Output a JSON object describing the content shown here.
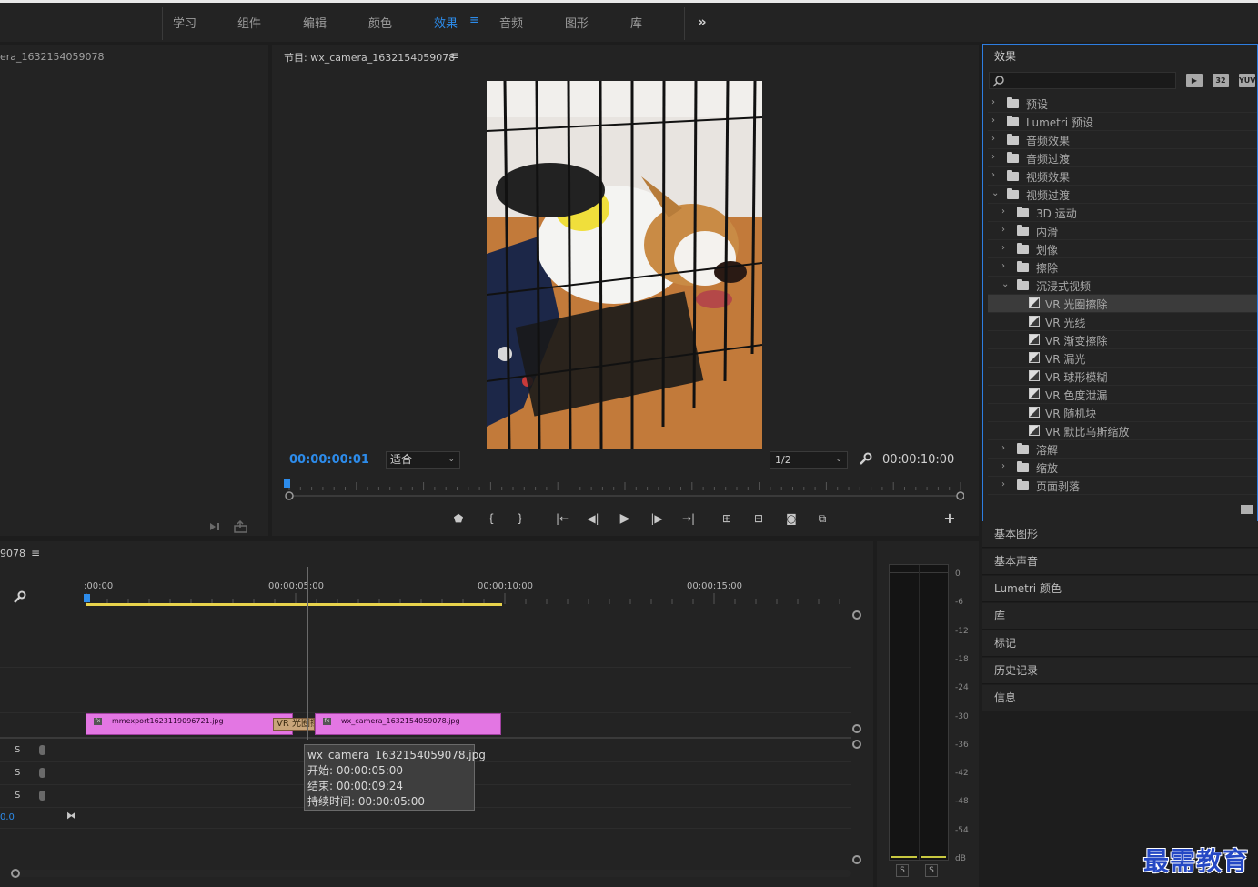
{
  "workspace_tabs": [
    {
      "label": "学习"
    },
    {
      "label": "组件"
    },
    {
      "label": "编辑"
    },
    {
      "label": "颜色"
    },
    {
      "label": "效果"
    },
    {
      "label": "音频"
    },
    {
      "label": "图形"
    },
    {
      "label": "库"
    }
  ],
  "workspace_active": "效果",
  "workspace_more": "»",
  "source": {
    "title": "era_1632154059078"
  },
  "program": {
    "title": "节目: wx_camera_1632154059078",
    "menu": "≡",
    "current_timecode": "00:00:00:01",
    "fit": "适合",
    "resolution": "1/2",
    "duration": "00:00:10:00"
  },
  "effects": {
    "title": "效果",
    "buttons": [
      "32",
      "YUV"
    ],
    "tree": [
      {
        "label": "预设",
        "kind": "preset",
        "level": 0,
        "expanded": false
      },
      {
        "label": "Lumetri 预设",
        "kind": "preset",
        "level": 0,
        "expanded": false
      },
      {
        "label": "音频效果",
        "kind": "folder",
        "level": 0,
        "expanded": false
      },
      {
        "label": "音频过渡",
        "kind": "folder",
        "level": 0,
        "expanded": false
      },
      {
        "label": "视频效果",
        "kind": "folder",
        "level": 0,
        "expanded": false
      },
      {
        "label": "视频过渡",
        "kind": "folder",
        "level": 0,
        "expanded": true
      },
      {
        "label": "3D 运动",
        "kind": "folder",
        "level": 1,
        "expanded": false
      },
      {
        "label": "内滑",
        "kind": "folder",
        "level": 1,
        "expanded": false
      },
      {
        "label": "划像",
        "kind": "folder",
        "level": 1,
        "expanded": false
      },
      {
        "label": "擦除",
        "kind": "folder",
        "level": 1,
        "expanded": false
      },
      {
        "label": "沉浸式视频",
        "kind": "folder",
        "level": 1,
        "expanded": true
      },
      {
        "label": "VR 光圈擦除",
        "kind": "effect",
        "level": 2,
        "selected": true
      },
      {
        "label": "VR 光线",
        "kind": "effect",
        "level": 2
      },
      {
        "label": "VR 渐变擦除",
        "kind": "effect",
        "level": 2
      },
      {
        "label": "VR 漏光",
        "kind": "effect",
        "level": 2
      },
      {
        "label": "VR 球形模糊",
        "kind": "effect",
        "level": 2
      },
      {
        "label": "VR 色度泄漏",
        "kind": "effect",
        "level": 2
      },
      {
        "label": "VR 随机块",
        "kind": "effect",
        "level": 2
      },
      {
        "label": "VR 默比乌斯缩放",
        "kind": "effect",
        "level": 2
      },
      {
        "label": "溶解",
        "kind": "folder",
        "level": 1,
        "expanded": false
      },
      {
        "label": "缩放",
        "kind": "folder",
        "level": 1,
        "expanded": false
      },
      {
        "label": "页面剥落",
        "kind": "folder",
        "level": 1,
        "expanded": false
      }
    ]
  },
  "side_panels": [
    {
      "label": "基本图形"
    },
    {
      "label": "基本声音"
    },
    {
      "label": "Lumetri 颜色"
    },
    {
      "label": "库"
    },
    {
      "label": "标记"
    },
    {
      "label": "历史记录"
    },
    {
      "label": "信息"
    }
  ],
  "timeline": {
    "sequence_title": "9078",
    "menu": "≡",
    "ruler_labels": [
      ":00:00",
      "00:00:05:00",
      "00:00:10:00",
      "00:00:15:00"
    ],
    "clips": [
      {
        "name": "mmexport1623119096721.jpg"
      },
      {
        "name": "wx_camera_1632154059078.jpg"
      }
    ],
    "transition_label": "VR 光圈擦",
    "audio_tracks": [
      {
        "solo": "S"
      },
      {
        "solo": "S"
      },
      {
        "solo": "S"
      }
    ],
    "master_volume": "0.0",
    "tooltip": {
      "name": "wx_camera_1632154059078.jpg",
      "start": "开始: 00:00:05:00",
      "end": "结束: 00:00:09:24",
      "duration": "持续时间: 00:00:05:00"
    }
  },
  "meter": {
    "db_labels": [
      "0",
      "-6",
      "-12",
      "-18",
      "-24",
      "-30",
      "-36",
      "-42",
      "-48",
      "-54",
      "dB"
    ],
    "solo_buttons": [
      "S",
      "S"
    ]
  },
  "watermark": "最需教育",
  "colors": {
    "accent": "#2d8ceb",
    "clip": "#e376e3",
    "work_area": "#e8d34c"
  }
}
